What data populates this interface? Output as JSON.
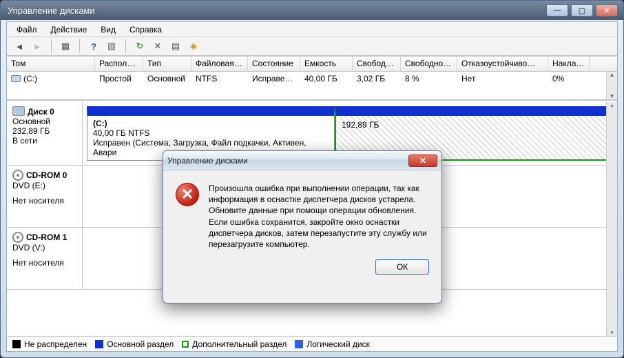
{
  "window": {
    "title": "Управление дисками"
  },
  "menu": {
    "file": "Файл",
    "action": "Действие",
    "view": "Вид",
    "help": "Справка"
  },
  "columns": {
    "volume": "Том",
    "layout": "Располо…",
    "type": "Тип",
    "fs": "Файловая с…",
    "status": "Состояние",
    "capacity": "Емкость",
    "free": "Свобод…",
    "free_pct": "Свободно %",
    "fault": "Отказоустойчиво…",
    "overhead": "Накладны…"
  },
  "volumes": [
    {
      "name": "(C:)",
      "layout": "Простой",
      "type": "Основной",
      "fs": "NTFS",
      "status": "Исправен…",
      "capacity": "40,00 ГБ",
      "free": "3,02 ГБ",
      "free_pct": "8 %",
      "fault": "Нет",
      "overhead": "0%"
    }
  ],
  "disks": {
    "disk0": {
      "name": "Диск 0",
      "type": "Основной",
      "size": "232,89 ГБ",
      "status": "В сети",
      "part_c": {
        "label": "(C:)",
        "line2": "40,00 ГБ NTFS",
        "line3": "Исправен (Система, Загрузка, Файл подкачки, Активен, Авари"
      },
      "part_unalloc": {
        "size": "192,89 ГБ"
      }
    },
    "cd0": {
      "name": "CD-ROM 0",
      "mount": "DVD (E:)",
      "status": "Нет носителя"
    },
    "cd1": {
      "name": "CD-ROM 1",
      "mount": "DVD (V:)",
      "status": "Нет носителя"
    }
  },
  "legend": {
    "unallocated": "Не распределен",
    "primary": "Основной раздел",
    "extended": "Дополнительный раздел",
    "logical": "Логический диск"
  },
  "dialog": {
    "title": "Управление дисками",
    "message": "Произошла ошибка при выполнении операции, так как информация в оснастке диспетчера дисков устарела. Обновите данные при помощи операции обновления.  Если ошибка сохранится, закройте окно оснастки диспетчера дисков, затем перезапустите эту службу или перезагрузите компьютер.",
    "ok": "ОК"
  }
}
